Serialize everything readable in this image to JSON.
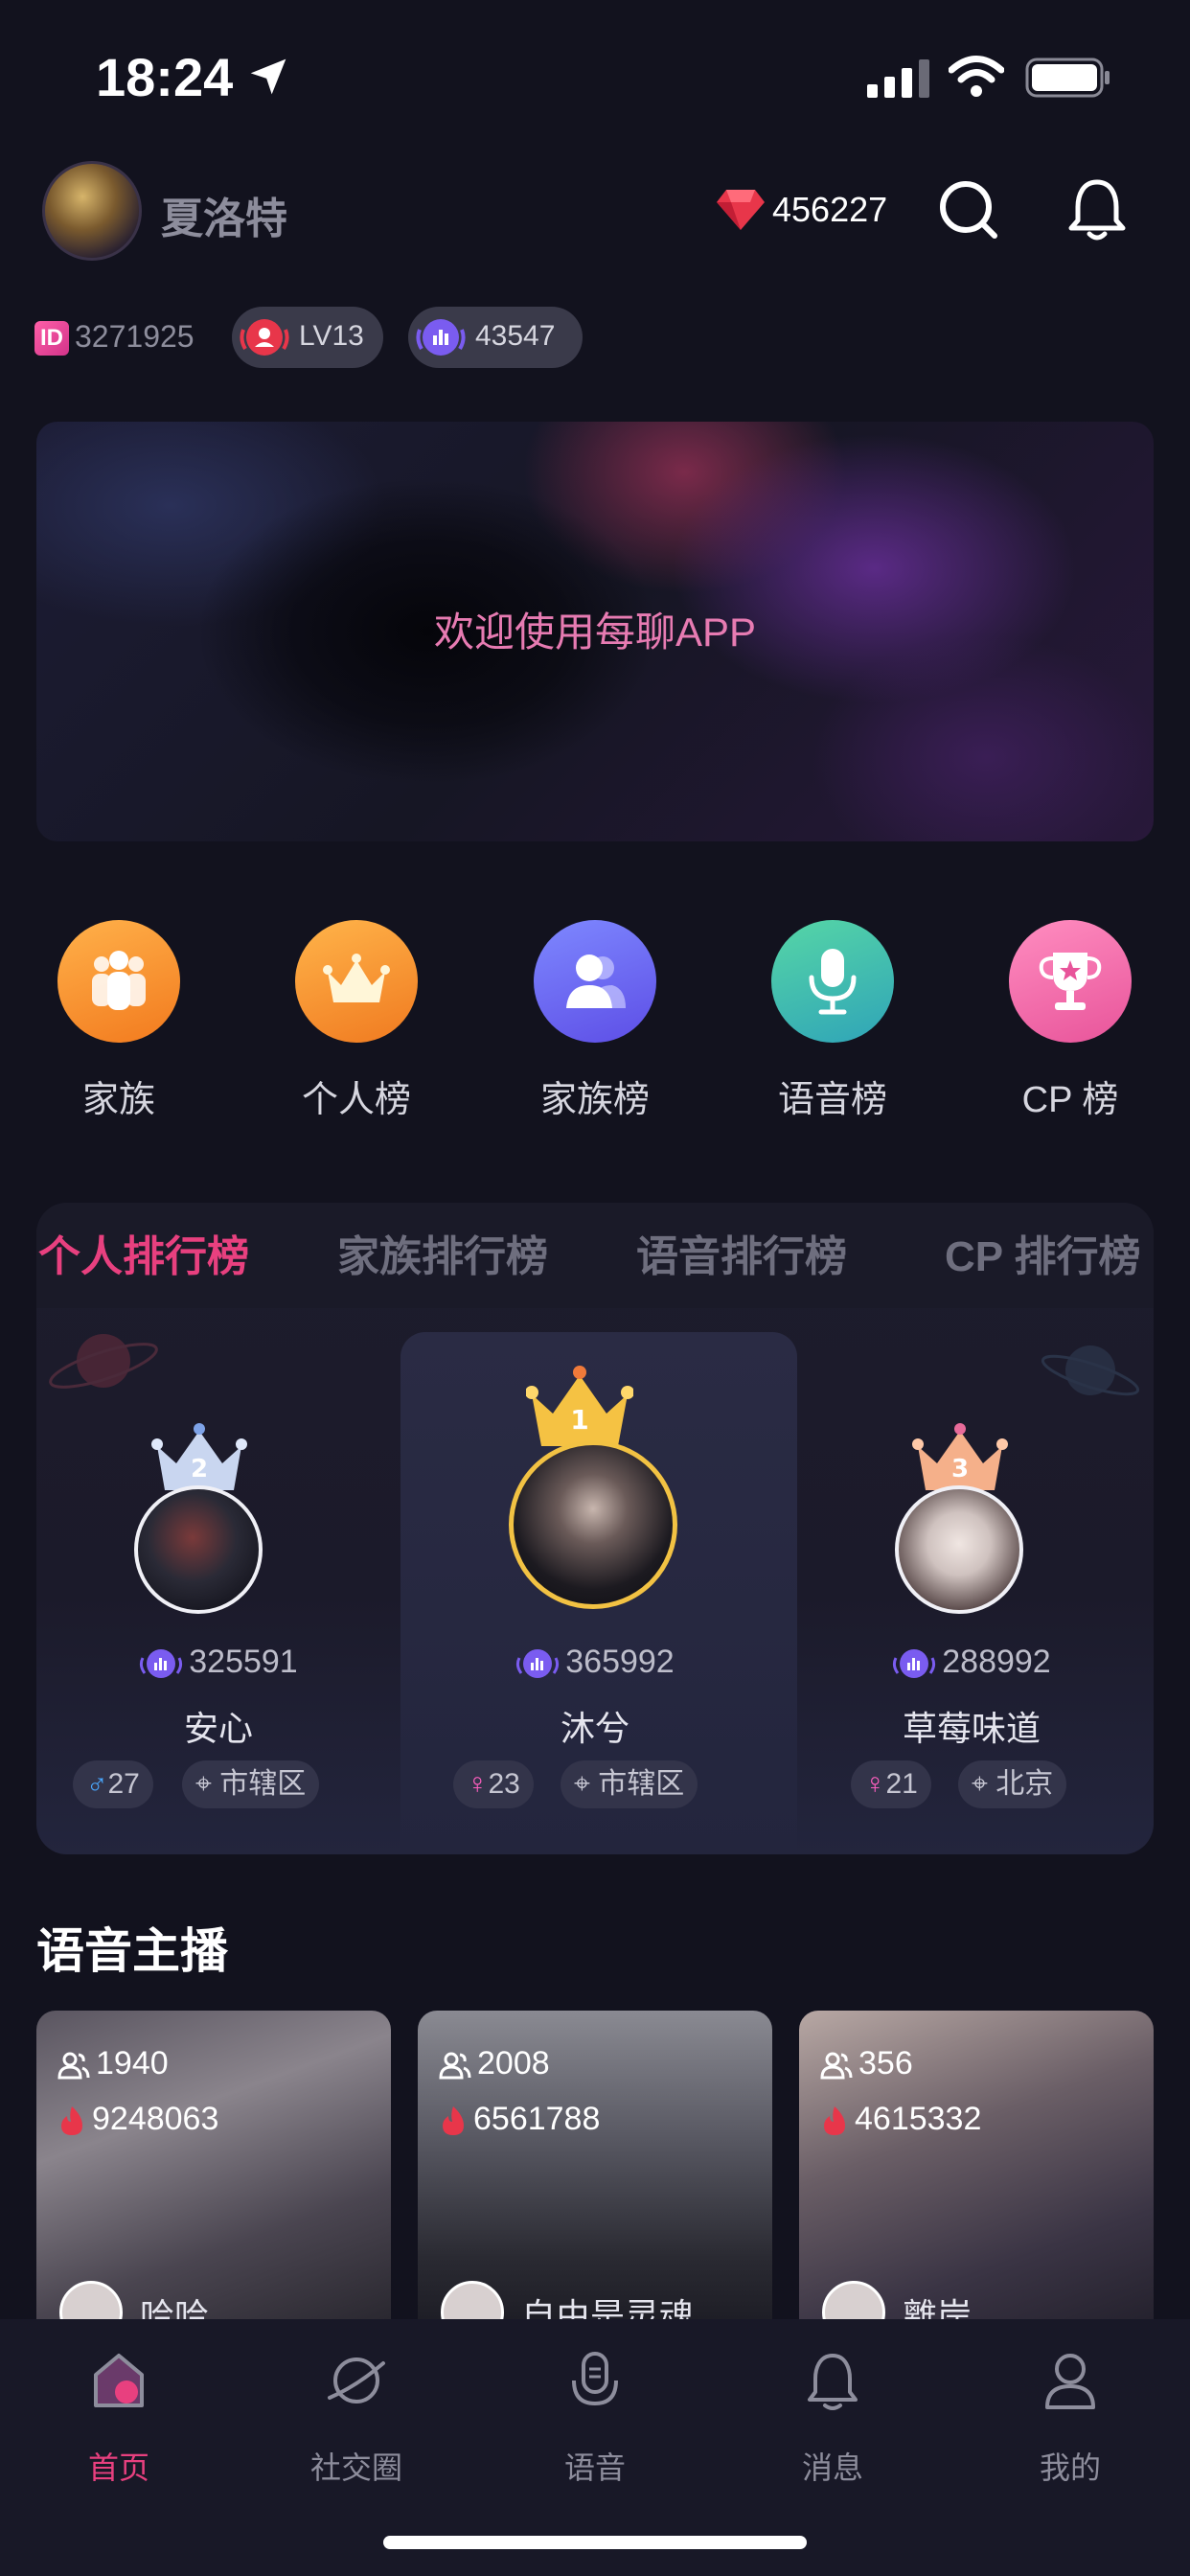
{
  "status_bar": {
    "time": "18:24"
  },
  "header": {
    "username": "夏洛特",
    "diamonds": "456227"
  },
  "profile_stats": {
    "id": "3271925",
    "id_label": "ID",
    "level": "LV13",
    "points": "43547"
  },
  "banner": {
    "text": "欢迎使用每聊APP"
  },
  "shortcuts": [
    {
      "label": "家族",
      "icon": "family-icon",
      "color": "#f7922e"
    },
    {
      "label": "个人榜",
      "icon": "crown-icon",
      "color": "#f39a2c"
    },
    {
      "label": "家族榜",
      "icon": "users-icon",
      "color": "#6a6df0"
    },
    {
      "label": "语音榜",
      "icon": "microphone-icon",
      "color": "#3fc3a6"
    },
    {
      "label": "CP 榜",
      "icon": "trophy-icon",
      "color": "#f06fa8"
    }
  ],
  "leaderboard": {
    "tabs": [
      "个人排行榜",
      "家族排行榜",
      "语音排行榜",
      "CP 排行榜"
    ],
    "active_tab": "个人排行榜",
    "ranks": [
      {
        "rank": "2",
        "score": "325591",
        "name": "安心",
        "gender_symbol": "♂",
        "age": "27",
        "location": "市辖区"
      },
      {
        "rank": "1",
        "score": "365992",
        "name": "沐兮",
        "gender_symbol": "♀",
        "age": "23",
        "location": "市辖区"
      },
      {
        "rank": "3",
        "score": "288992",
        "name": "草莓味道",
        "gender_symbol": "♀",
        "age": "21",
        "location": "北京"
      }
    ]
  },
  "voice_section": {
    "title": "语音主播",
    "anchors": [
      {
        "viewers": "1940",
        "heat": "9248063",
        "name": "哈哈"
      },
      {
        "viewers": "2008",
        "heat": "6561788",
        "name": "自由是灵魂…"
      },
      {
        "viewers": "356",
        "heat": "4615332",
        "name": "離岸"
      }
    ]
  },
  "tabbar": {
    "items": [
      {
        "label": "首页",
        "icon": "home-icon"
      },
      {
        "label": "社交圈",
        "icon": "planet-icon"
      },
      {
        "label": "语音",
        "icon": "voice-icon"
      },
      {
        "label": "消息",
        "icon": "bell-icon"
      },
      {
        "label": "我的",
        "icon": "person-icon"
      }
    ],
    "active": "首页"
  },
  "colors": {
    "accent": "#e8407f",
    "background": "#12121e",
    "card": "#1d1c2c"
  }
}
